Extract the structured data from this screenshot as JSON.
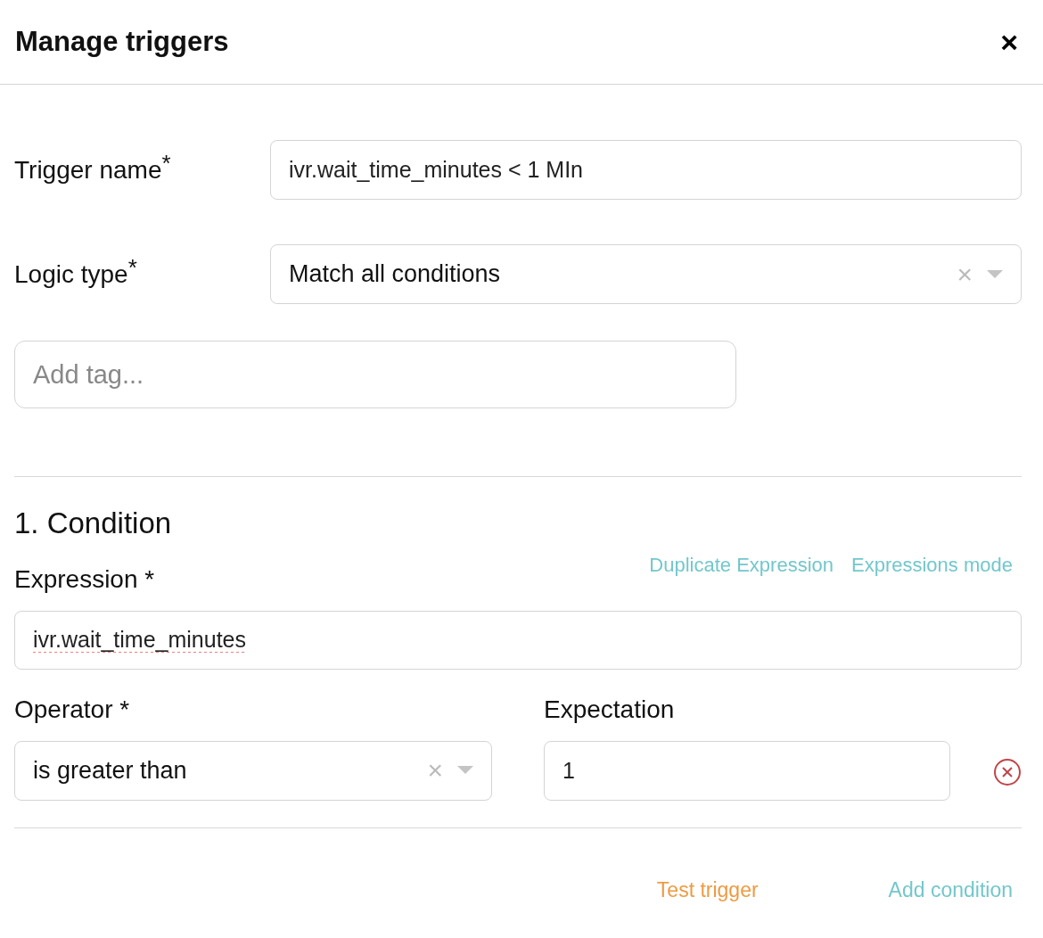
{
  "dialog": {
    "title": "Manage triggers",
    "close": "×"
  },
  "trigger_name": {
    "label": "Trigger name",
    "required_mark": "*",
    "value": "ivr.wait_time_minutes < 1 MIn"
  },
  "logic_type": {
    "label": "Logic type",
    "required_mark": "*",
    "value": "Match all conditions",
    "clear": "×"
  },
  "tags": {
    "placeholder": "Add tag..."
  },
  "conditions": [
    {
      "heading": "1. Condition",
      "links": [
        "Duplicate Expression",
        "Expressions mode"
      ],
      "expression": {
        "label": "Expression *",
        "value": "ivr.wait_time_minutes",
        "misspelled": true
      },
      "operator": {
        "label": "Operator *",
        "value": "is greater than",
        "clear": "×"
      },
      "expectation": {
        "label": "Expectation",
        "value": "1"
      }
    }
  ],
  "footer": {
    "test": "Test trigger",
    "add": "Add condition"
  }
}
